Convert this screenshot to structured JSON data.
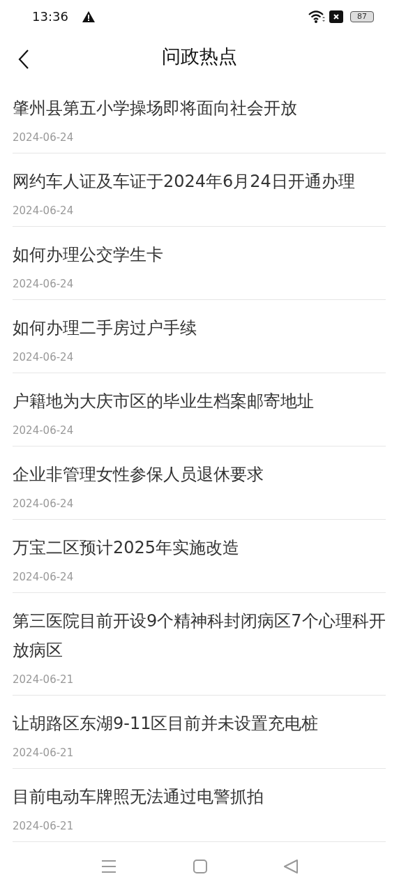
{
  "status_bar": {
    "time": "13:36",
    "battery": "87"
  },
  "header": {
    "title": "问政热点"
  },
  "items": [
    {
      "title": "肇州县第五小学操场即将面向社会开放",
      "date": "2024-06-24"
    },
    {
      "title": "网约车人证及车证于2024年6月24日开通办理",
      "date": "2024-06-24"
    },
    {
      "title": "如何办理公交学生卡",
      "date": "2024-06-24"
    },
    {
      "title": "如何办理二手房过户手续",
      "date": "2024-06-24"
    },
    {
      "title": "户籍地为大庆市区的毕业生档案邮寄地址",
      "date": "2024-06-24"
    },
    {
      "title": "企业非管理女性参保人员退休要求",
      "date": "2024-06-24"
    },
    {
      "title": "万宝二区预计2025年实施改造",
      "date": "2024-06-24"
    },
    {
      "title": "第三医院目前开设9个精神科封闭病区7个心理科开放病区",
      "date": "2024-06-21"
    },
    {
      "title": "让胡路区东湖9-11区目前并未设置充电桩",
      "date": "2024-06-21"
    },
    {
      "title": "目前电动车牌照无法通过电警抓拍",
      "date": "2024-06-21"
    }
  ]
}
